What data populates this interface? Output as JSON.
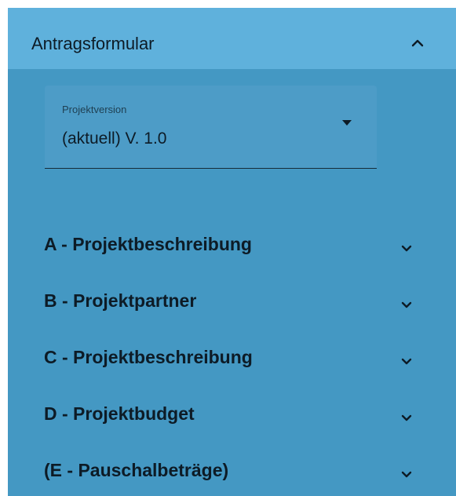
{
  "panel": {
    "title": "Antragsformular",
    "expanded": true,
    "collapse_icon": "chevron-up-icon"
  },
  "version_select": {
    "label": "Projektversion",
    "value": "(aktuell) V. 1.0",
    "icon": "caret-down-icon"
  },
  "sections": [
    {
      "label": "A - Projektbeschreibung",
      "icon": "chevron-down-icon"
    },
    {
      "label": "B - Projektpartner",
      "icon": "chevron-down-icon"
    },
    {
      "label": "C - Projektbeschreibung",
      "icon": "chevron-down-icon"
    },
    {
      "label": "D - Projektbudget",
      "icon": "chevron-down-icon"
    },
    {
      "label": "(E - Pauschalbeträge)",
      "icon": "chevron-down-icon"
    }
  ],
  "colors": {
    "panel_background": "#4498c3",
    "header_background": "#5fb1dc",
    "text": "#0d1b26"
  }
}
